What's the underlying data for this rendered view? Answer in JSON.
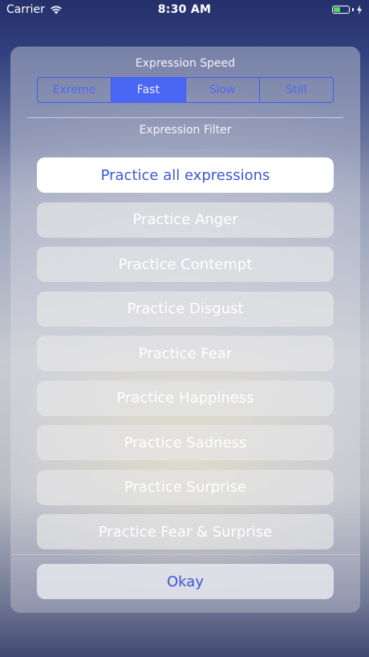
{
  "status_bar": {
    "carrier": "Carrier",
    "time": "8:30 AM",
    "battery_level": 0.45,
    "battery_color": "#4cd964",
    "icons": [
      "wifi-icon",
      "battery-icon",
      "charging-icon"
    ]
  },
  "speed": {
    "label": "Expression Speed",
    "selected": "Fast",
    "segments": [
      {
        "label": "Exreme"
      },
      {
        "label": "Fast"
      },
      {
        "label": "Slow"
      },
      {
        "label": "Still"
      }
    ]
  },
  "filter": {
    "label": "Expression Filter",
    "selected": "Practice all expressions",
    "options": [
      {
        "label": "Practice all expressions"
      },
      {
        "label": "Practice Anger"
      },
      {
        "label": "Practice Contempt"
      },
      {
        "label": "Practice Disgust"
      },
      {
        "label": "Practice Fear"
      },
      {
        "label": "Practice Happiness"
      },
      {
        "label": "Practice Sadness"
      },
      {
        "label": "Practice Surprise"
      },
      {
        "label": "Practice Fear & Surprise"
      }
    ]
  },
  "actions": {
    "okay_label": "Okay"
  },
  "colors": {
    "accent": "#3b57d9",
    "segment_border": "#3b5cf6",
    "segment_selected_bg": "#4a66f5"
  }
}
